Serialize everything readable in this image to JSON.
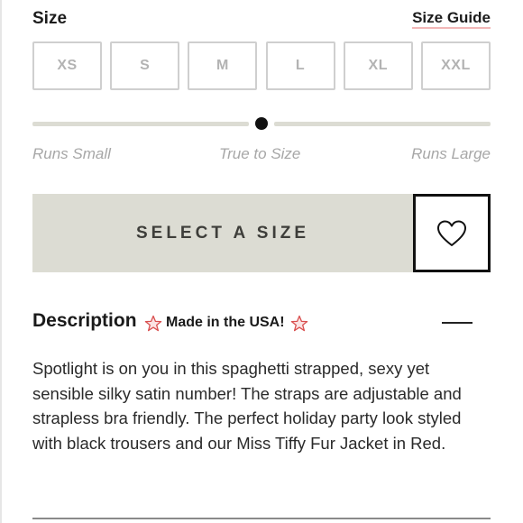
{
  "size_section": {
    "title": "Size",
    "guide_link": "Size Guide",
    "sizes": [
      "XS",
      "S",
      "M",
      "L",
      "XL",
      "XXL"
    ]
  },
  "fit_scale": {
    "labels": {
      "left": "Runs Small",
      "middle": "True to Size",
      "right": "Runs Large"
    },
    "position": 0.5
  },
  "actions": {
    "select_label": "SELECT A SIZE",
    "wishlist_icon": "heart-outline-icon"
  },
  "description": {
    "title": "Description",
    "badge_text": "Made in the USA!",
    "badge_icon": "star-icon",
    "star_color": "#f0a0a0",
    "body": "Spotlight is on you in this spaghetti strapped, sexy yet sensible silky satin number! The straps are adjustable and strapless bra friendly. The perfect holiday party look styled with black trousers and our Miss Tiffy Fur Jacket in Red."
  },
  "colors": {
    "button_bg": "#dcdcd3",
    "muted_text": "#a7a7a7",
    "link_underline": "#f2b7b7"
  }
}
